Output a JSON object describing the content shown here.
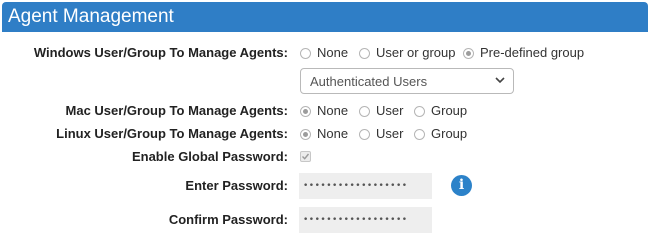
{
  "header": {
    "title": "Agent Management"
  },
  "windows": {
    "label": "Windows User/Group To Manage Agents:",
    "options": [
      "None",
      "User or group",
      "Pre-defined group"
    ],
    "selected": "Pre-defined group",
    "group_select": {
      "value": "Authenticated Users"
    }
  },
  "mac": {
    "label": "Mac User/Group To Manage Agents:",
    "options": [
      "None",
      "User",
      "Group"
    ],
    "selected": "None"
  },
  "linux": {
    "label": "Linux User/Group To Manage Agents:",
    "options": [
      "None",
      "User",
      "Group"
    ],
    "selected": "None"
  },
  "global_password": {
    "label": "Enable Global Password:",
    "checked": true
  },
  "enter_password": {
    "label": "Enter Password:",
    "value": "••••••••••••••••••"
  },
  "confirm_password": {
    "label": "Confirm Password:",
    "value": "••••••••••••••••••"
  },
  "icons": {
    "info": "info-icon",
    "dropdown": "chevron-down-icon",
    "checkmark": "checkmark-icon"
  },
  "colors": {
    "header_bg": "#2f7ec6",
    "info_bg": "#2c82c9"
  }
}
